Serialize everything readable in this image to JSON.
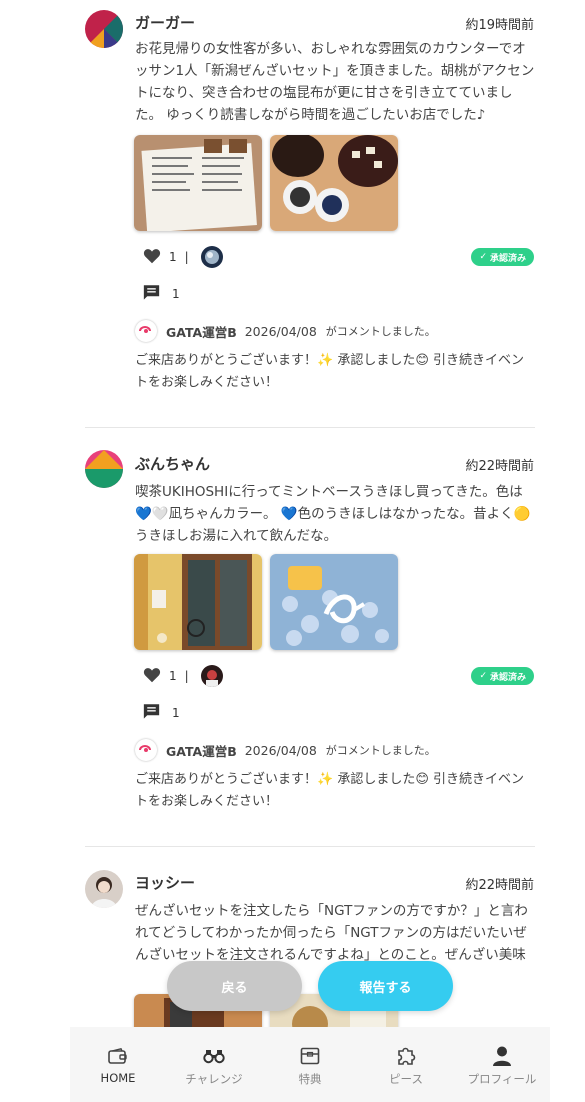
{
  "posts": [
    {
      "author": "ガーガー",
      "time": "約19時間前",
      "text": "お花見帰りの女性客が多い、おしゃれな雰囲気のカウンターでオッサン1人「新潟ぜんざいセット」を頂きました。胡桃がアクセントになり、突き合わせの塩昆布が更に甘さを引き立てていました。 ゆっくり読書しながら時間を過ごしたいお店でした♪",
      "likes": "1",
      "comments": "1",
      "badge": "承認済み",
      "reply": {
        "who": "GATA運営B",
        "date": "2026/04/08",
        "did": "がコメントしました。",
        "text": "ご来店ありがとうございます！✨ 承認しました😊 引き続きイベントをお楽しみください！"
      }
    },
    {
      "author": "ぶんちゃん",
      "time": "約22時間前",
      "text": "喫茶UKIHOSHIに行ってミントベースうきほし買ってきた。色は💙🤍凪ちゃんカラー。 💙色のうきほしはなかったな。昔よく🟡うきほしお湯に入れて飲んだな。",
      "likes": "1",
      "comments": "1",
      "badge": "承認済み",
      "reply": {
        "who": "GATA運営B",
        "date": "2026/04/08",
        "did": "がコメントしました。",
        "text": "ご来店ありがとうございます！✨ 承認しました😊 引き続きイベントをお楽しみください！"
      }
    },
    {
      "author": "ヨッシー",
      "time": "約22時間前",
      "text": "ぜんざいセットを注文したら「NGTファンの方ですか？」と言われてどうしてわかったか伺ったら「NGTファンの方はだいたいぜんざいセットを注文されるんですよね」とのこと。ぜんざい美味"
    }
  ],
  "buttons": {
    "back": "戻る",
    "report": "報告する"
  },
  "tabs": [
    {
      "label": "HOME",
      "icon": "wallet-icon"
    },
    {
      "label": "チャレンジ",
      "icon": "binoculars-icon"
    },
    {
      "label": "特典",
      "icon": "gift-box-icon"
    },
    {
      "label": "ピース",
      "icon": "puzzle-icon"
    },
    {
      "label": "プロフィール",
      "icon": "person-icon"
    }
  ],
  "colors": {
    "accent": "#35ccf0",
    "badge": "#2ed08a",
    "back_button": "#c8c8c8"
  }
}
